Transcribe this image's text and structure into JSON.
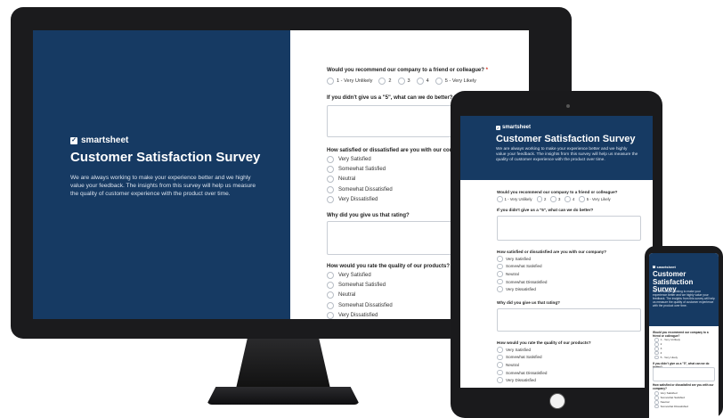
{
  "survey": {
    "brand": "smartsheet",
    "logo_glyph": "✓",
    "title": "Customer Satisfaction Survey",
    "description": "We are always working to make your experience better and we highly value your feedback. The insights from this survey will help us measure the quality of customer experience with the product over time.",
    "colors": {
      "hero_bg": "#163a63",
      "required": "#d4301f"
    },
    "q1": {
      "label": "Would you recommend our company to a friend or colleague?",
      "required_mark": "*",
      "scale": [
        "1 - Very Unlikely",
        "2",
        "3",
        "4",
        "5 - Very Likely"
      ]
    },
    "q2": {
      "label": "If you didn't give us a \"5\", what can we do better?"
    },
    "q3": {
      "label": "How satisfied or dissatisfied are you with our company?",
      "options": [
        "Very Satisfied",
        "Somewhat Satisfied",
        "Neutral",
        "Somewhat Dissatisfied",
        "Very Dissatisfied"
      ]
    },
    "q4": {
      "label": "Why did you give us that rating?"
    },
    "q5": {
      "label": "How would you rate the quality of our products?",
      "options": [
        "Very Satisfied",
        "Somewhat Satisfied",
        "Neutral",
        "Somewhat Dissatisfied",
        "Very Dissatisfied"
      ]
    },
    "phone_q3_options": [
      "Very Satisfied",
      "Somewhat Satisfied",
      "Neutral",
      "Somewhat Dissatisfied"
    ]
  }
}
